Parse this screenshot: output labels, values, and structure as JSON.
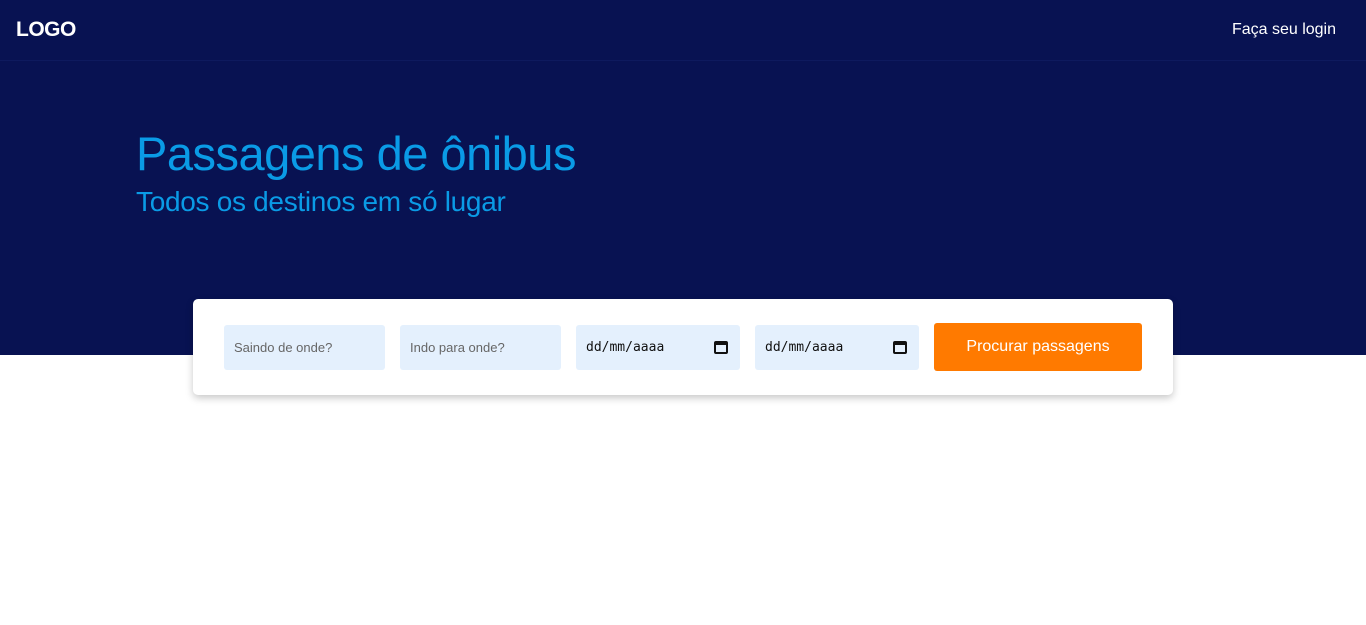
{
  "header": {
    "logo": "LOGO",
    "login_label": "Faça seu login"
  },
  "hero": {
    "title": "Passagens de ônibus",
    "subtitle": "Todos os destinos em só lugar"
  },
  "search": {
    "origin_placeholder": "Saindo de onde?",
    "destination_placeholder": "Indo para onde?",
    "departure_date": "dd/mm/aaaa",
    "return_date": "dd/mm/aaaa",
    "button_label": "Procurar passagens"
  },
  "icons": {
    "date_icon": "calendar-icon"
  },
  "colors": {
    "navy_background": "#081252",
    "title_blue": "#0a9be6",
    "input_background": "#e4f0fd",
    "button_orange": "#ff7a00"
  }
}
